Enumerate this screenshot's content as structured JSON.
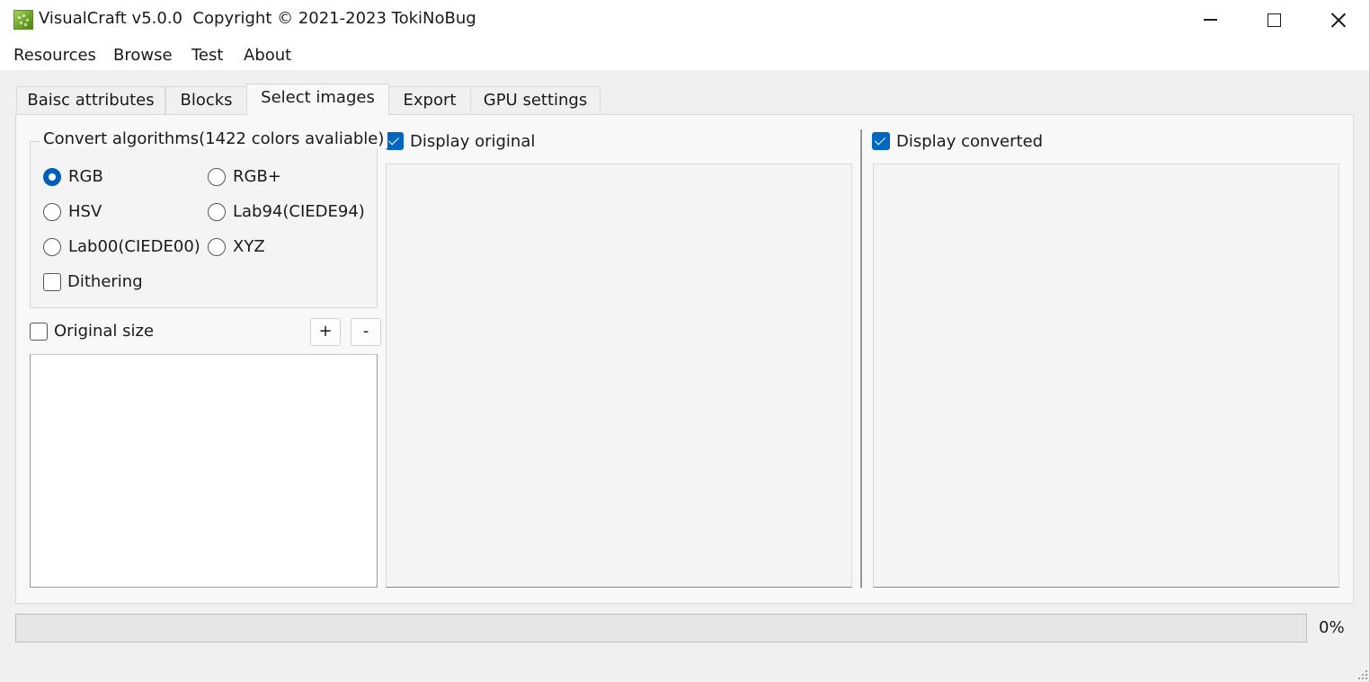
{
  "window": {
    "title": "VisualCraft v5.0.0  Copyright © 2021-2023 TokiNoBug"
  },
  "menu": [
    "Resources",
    "Browse",
    "Test",
    "About"
  ],
  "tabs": [
    {
      "label": "Baisc attributes"
    },
    {
      "label": "Blocks"
    },
    {
      "label": "Select images",
      "active": true
    },
    {
      "label": "Export"
    },
    {
      "label": "GPU settings"
    }
  ],
  "algorithms": {
    "group_title": "Convert algorithms(1422 colors avaliable)",
    "options": [
      {
        "label": "RGB",
        "selected": true
      },
      {
        "label": "RGB+",
        "selected": false
      },
      {
        "label": "HSV",
        "selected": false
      },
      {
        "label": "Lab94(CIEDE94)",
        "selected": false
      },
      {
        "label": "Lab00(CIEDE00)",
        "selected": false
      },
      {
        "label": "XYZ",
        "selected": false
      }
    ],
    "dithering": {
      "label": "Dithering",
      "checked": false
    }
  },
  "original_size": {
    "label": "Original size",
    "checked": false
  },
  "zoom": {
    "plus": "+",
    "minus": "-"
  },
  "display_original": {
    "label": "Display original",
    "checked": true
  },
  "display_converted": {
    "label": "Display converted",
    "checked": true
  },
  "progress": {
    "value": 0,
    "text": "0%"
  },
  "colors": {
    "accent": "#0067c0",
    "progress_fill": "#06b025"
  }
}
